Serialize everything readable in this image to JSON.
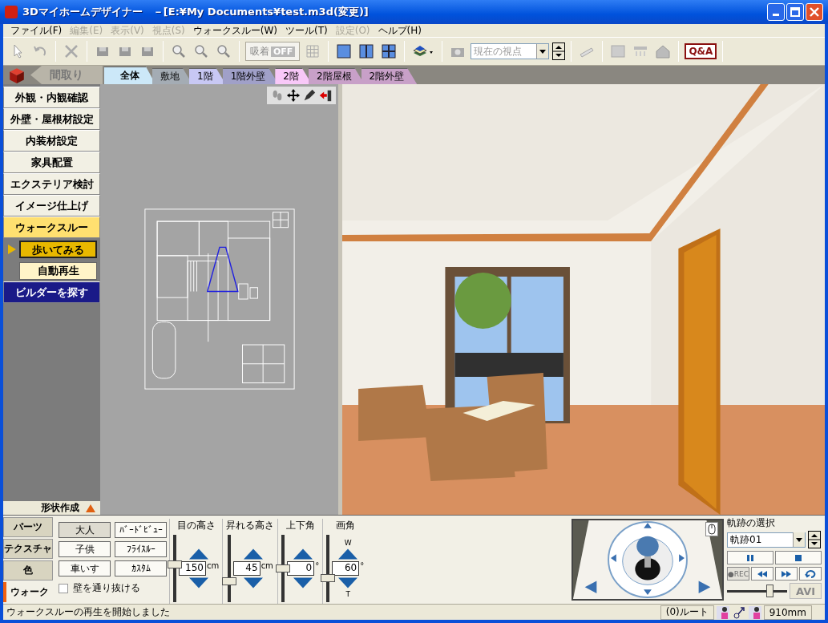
{
  "window": {
    "title": "3Dマイホームデザイナー　－[E:¥My Documents¥test.m3d(変更)]"
  },
  "menu": [
    {
      "label": "ファイル(F)",
      "disabled": false
    },
    {
      "label": "編集(E)",
      "disabled": true
    },
    {
      "label": "表示(V)",
      "disabled": true
    },
    {
      "label": "視点(S)",
      "disabled": true
    },
    {
      "label": "ウォークスルー(W)",
      "disabled": false
    },
    {
      "label": "ツール(T)",
      "disabled": false
    },
    {
      "label": "設定(O)",
      "disabled": true
    },
    {
      "label": "ヘルプ(H)",
      "disabled": false
    }
  ],
  "toolbar": {
    "snap": {
      "label": "吸着",
      "state": "OFF"
    },
    "viewpoint": {
      "value": "現在の視点",
      "disabled": true
    },
    "help_button": "Q&A"
  },
  "mode_back": "間取り",
  "tabs": [
    {
      "label": "全体",
      "color": "#cce8f8",
      "selected": true
    },
    {
      "label": "敷地",
      "color": "#a4acb4",
      "selected": false
    },
    {
      "label": "1階",
      "color": "#c8c8f4",
      "selected": false
    },
    {
      "label": "1階外壁",
      "color": "#a0a0c8",
      "selected": false
    },
    {
      "label": "2階",
      "color": "#f8c8f8",
      "selected": false
    },
    {
      "label": "2階屋根",
      "color": "#c8a0c8",
      "selected": false
    },
    {
      "label": "2階外壁",
      "color": "#c8a0c8",
      "selected": false
    }
  ],
  "sidebar": {
    "items": [
      {
        "label": "外観・内観確認",
        "kind": "mode",
        "selected": false
      },
      {
        "label": "外壁・屋根材設定",
        "kind": "mode",
        "selected": false
      },
      {
        "label": "内装材設定",
        "kind": "mode",
        "selected": false
      },
      {
        "label": "家具配置",
        "kind": "mode",
        "selected": false
      },
      {
        "label": "エクステリア検討",
        "kind": "mode",
        "selected": false
      },
      {
        "label": "イメージ仕上げ",
        "kind": "mode",
        "selected": false
      },
      {
        "label": "ウォークスルー",
        "kind": "mode",
        "selected": true,
        "children": [
          {
            "label": "歩いてみる",
            "selected": true
          },
          {
            "label": "自動再生",
            "selected": false
          }
        ]
      },
      {
        "label": "ビルダーを探す",
        "kind": "link",
        "selected": false
      }
    ],
    "footer": "形状作成"
  },
  "bottom": {
    "tabs": [
      {
        "label": "パーツ",
        "selected": false
      },
      {
        "label": "テクスチャ",
        "selected": false
      },
      {
        "label": "色",
        "selected": false
      },
      {
        "label": "ウォーク",
        "selected": true
      }
    ],
    "presets": [
      {
        "label": "大人",
        "selected": true
      },
      {
        "label": "ﾊﾞｰﾄﾞﾋﾞｭｰ",
        "selected": false
      },
      {
        "label": "子供",
        "selected": false
      },
      {
        "label": "ﾌﾗｲｽﾙｰ",
        "selected": false
      },
      {
        "label": "車いす",
        "selected": false
      },
      {
        "label": "ｶｽﾀﾑ",
        "selected": false
      }
    ],
    "pass_walls": {
      "label": "壁を通り抜ける",
      "checked": false
    },
    "sliders": [
      {
        "label": "目の高さ",
        "value": "150",
        "unit": "cm",
        "level": 0.55
      },
      {
        "label": "昇れる高さ",
        "value": "45",
        "unit": "cm",
        "level": 0.3
      },
      {
        "label": "上下角",
        "value": "0",
        "unit": "°",
        "level": 0.5
      },
      {
        "label": "画角",
        "value": "60",
        "unit": "°",
        "level": 0.35,
        "top": "W",
        "bottom": "T"
      }
    ]
  },
  "track": {
    "label": "軌跡の選択",
    "value": "軌跡01",
    "buttons": [
      {
        "kind": "pause",
        "disabled": false
      },
      {
        "kind": "stop",
        "disabled": false
      },
      {
        "kind": "rec",
        "label": "●REC",
        "disabled": true
      },
      {
        "kind": "rewind",
        "disabled": false
      },
      {
        "kind": "forward",
        "disabled": false
      },
      {
        "kind": "loop",
        "disabled": false
      }
    ],
    "level": 0.7,
    "avi": {
      "label": "AVI",
      "disabled": true
    }
  },
  "status_bar": {
    "message": "ウォークスルーの再生を開始しました",
    "route": "(0)ルート",
    "scale": "910mm"
  }
}
